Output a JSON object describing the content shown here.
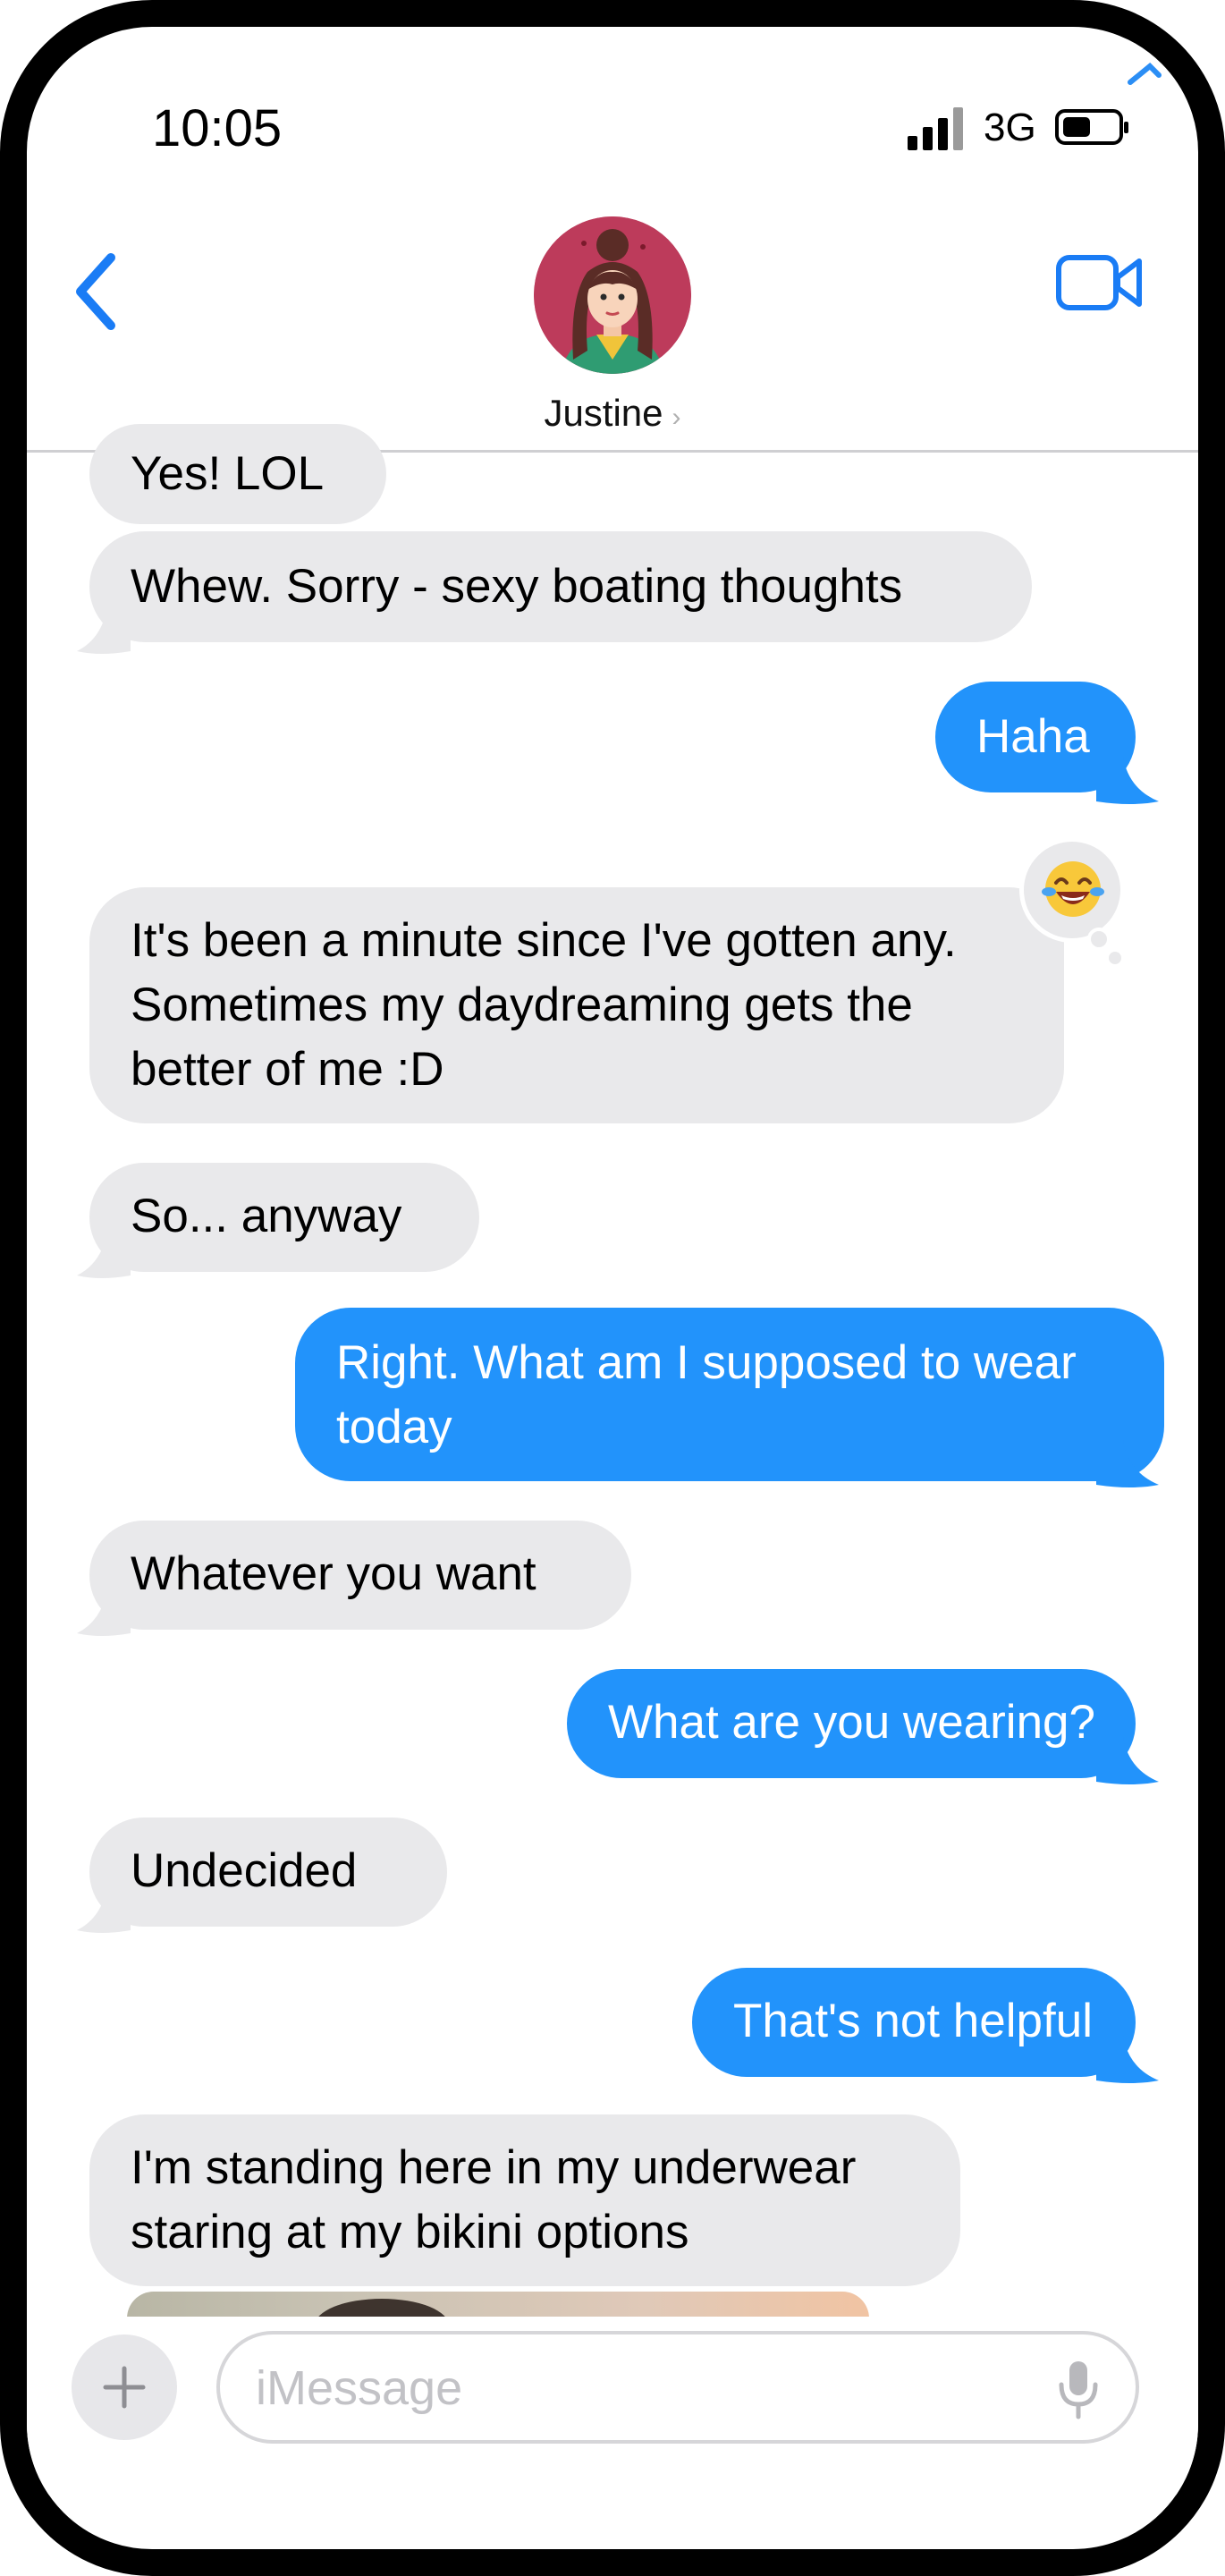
{
  "status_bar": {
    "time": "10:05",
    "network": "3G"
  },
  "header": {
    "contact_name": "Justine",
    "contact_chevron": "›"
  },
  "colors": {
    "incoming_bubble": "#e9e9eb",
    "outgoing_bubble": "#2293fb",
    "accent": "#1a7cf5"
  },
  "messages": [
    {
      "dir": "in",
      "lines": [
        "Yes!  LOL"
      ]
    },
    {
      "dir": "in",
      "lines": [
        "Whew.  Sorry - sexy boating thoughts"
      ]
    },
    {
      "dir": "out",
      "lines": [
        "Haha"
      ],
      "reaction": "face-with-tears-of-joy"
    },
    {
      "dir": "in",
      "lines": [
        "It's been a minute since I've gotten any.",
        "Sometimes my daydreaming gets the",
        "better of me :D"
      ]
    },
    {
      "dir": "in",
      "lines": [
        "So... anyway"
      ]
    },
    {
      "dir": "out",
      "lines": [
        "Right.  What am I supposed to wear",
        "today"
      ]
    },
    {
      "dir": "in",
      "lines": [
        "Whatever you want"
      ]
    },
    {
      "dir": "out",
      "lines": [
        "What are you wearing?"
      ]
    },
    {
      "dir": "in",
      "lines": [
        "Undecided"
      ]
    },
    {
      "dir": "out",
      "lines": [
        "That's not helpful"
      ]
    },
    {
      "dir": "in",
      "lines": [
        "I'm standing here in my underwear",
        "staring at my bikini options"
      ]
    }
  ],
  "composer": {
    "placeholder": "iMessage"
  },
  "icons": {
    "back": "chevron-left-icon",
    "video": "video-camera-icon",
    "plus": "plus-icon",
    "mic": "microphone-icon",
    "reaction": "face-with-tears-of-joy"
  }
}
